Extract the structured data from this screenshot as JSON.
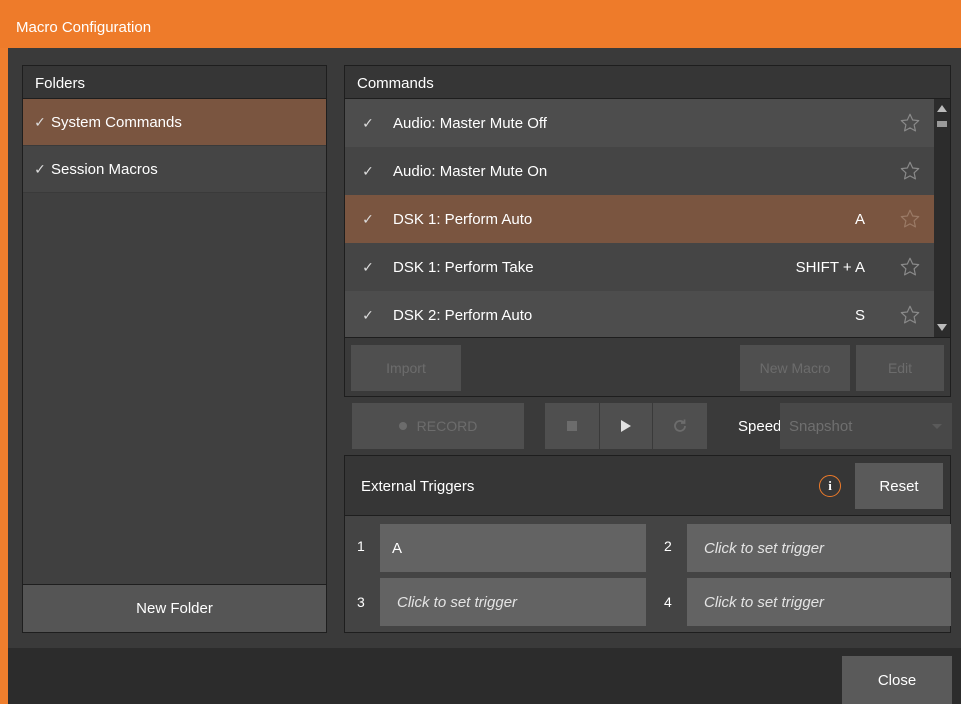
{
  "window": {
    "title": "Macro Configuration",
    "accent": "#ee7b2a",
    "selection": "#7a5540"
  },
  "folders": {
    "header": "Folders",
    "items": [
      {
        "label": "System Commands",
        "checked": "✓",
        "selected": true
      },
      {
        "label": "Session Macros",
        "checked": "✓",
        "selected": false
      }
    ],
    "new_folder_label": "New Folder"
  },
  "commands": {
    "header": "Commands",
    "rows": [
      {
        "check": "✓",
        "name": "Audio: Master Mute Off",
        "shortcut": "",
        "icon": "star-outline-icon"
      },
      {
        "check": "✓",
        "name": "Audio: Master Mute On",
        "shortcut": "",
        "icon": "star-outline-icon"
      },
      {
        "check": "✓",
        "name": "DSK 1: Perform Auto",
        "shortcut": "A",
        "icon": "star-outline-icon",
        "selected": true
      },
      {
        "check": "✓",
        "name": "DSK 1: Perform Take",
        "shortcut": "SHIFT + A",
        "icon": "star-outline-icon"
      },
      {
        "check": "✓",
        "name": "DSK 2: Perform Auto",
        "shortcut": "S",
        "icon": "star-outline-icon"
      }
    ],
    "import_label": "Import",
    "new_macro_label": "New Macro",
    "edit_label": "Edit"
  },
  "record": {
    "record_label": "RECORD",
    "speed_label": "Speed",
    "speed_value": "Snapshot"
  },
  "triggers": {
    "title": "External Triggers",
    "info_glyph": "i",
    "reset_label": "Reset",
    "slots": [
      {
        "num": "1",
        "value": "A",
        "placeholder": false
      },
      {
        "num": "2",
        "value": "Click to set trigger",
        "placeholder": true
      },
      {
        "num": "3",
        "value": "Click to set trigger",
        "placeholder": true
      },
      {
        "num": "4",
        "value": "Click to set trigger",
        "placeholder": true
      }
    ]
  },
  "footer": {
    "close_label": "Close"
  }
}
